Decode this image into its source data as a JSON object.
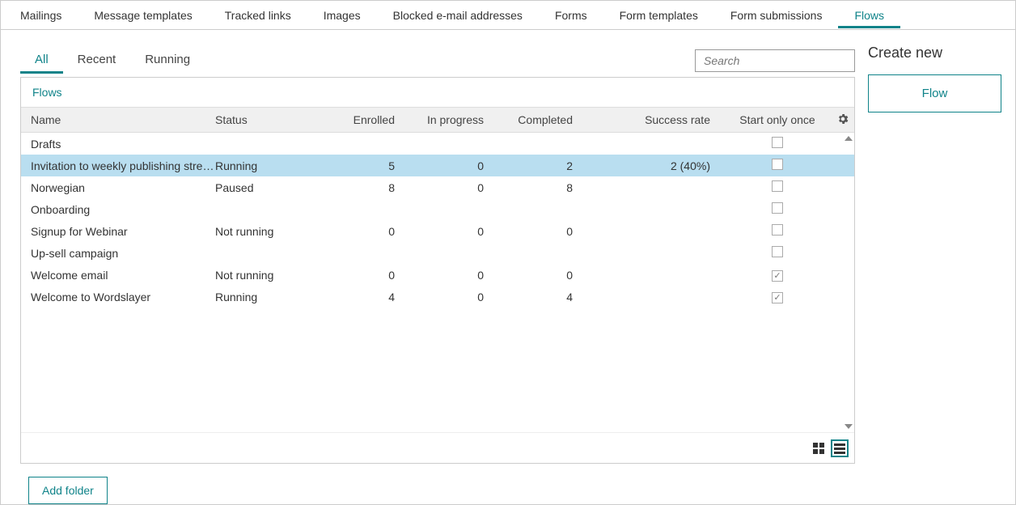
{
  "topnav": {
    "tabs": [
      {
        "label": "Mailings"
      },
      {
        "label": "Message templates"
      },
      {
        "label": "Tracked links"
      },
      {
        "label": "Images"
      },
      {
        "label": "Blocked e-mail addresses"
      },
      {
        "label": "Forms"
      },
      {
        "label": "Form templates"
      },
      {
        "label": "Form submissions"
      },
      {
        "label": "Flows",
        "active": true
      }
    ]
  },
  "side": {
    "heading": "Create new",
    "button": "Flow"
  },
  "subtabs": [
    {
      "label": "All",
      "active": true
    },
    {
      "label": "Recent"
    },
    {
      "label": "Running"
    }
  ],
  "search": {
    "placeholder": "Search"
  },
  "breadcrumb": "Flows",
  "grid": {
    "headers": {
      "name": "Name",
      "status": "Status",
      "enrolled": "Enrolled",
      "in_progress": "In progress",
      "completed": "Completed",
      "success_rate": "Success rate",
      "start_once": "Start only once"
    },
    "rows": [
      {
        "name": "Drafts",
        "status": "",
        "enrolled": "",
        "in_progress": "",
        "completed": "",
        "success_rate": "",
        "start_once": false,
        "selected": false
      },
      {
        "name": "Invitation to weekly publishing strea...",
        "status": "Running",
        "enrolled": "5",
        "in_progress": "0",
        "completed": "2",
        "success_rate": "2 (40%)",
        "start_once": false,
        "selected": true
      },
      {
        "name": "Norwegian",
        "status": "Paused",
        "enrolled": "8",
        "in_progress": "0",
        "completed": "8",
        "success_rate": "",
        "start_once": false,
        "selected": false
      },
      {
        "name": "Onboarding",
        "status": "",
        "enrolled": "",
        "in_progress": "",
        "completed": "",
        "success_rate": "",
        "start_once": false,
        "selected": false
      },
      {
        "name": "Signup for Webinar",
        "status": "Not running",
        "enrolled": "0",
        "in_progress": "0",
        "completed": "0",
        "success_rate": "",
        "start_once": false,
        "selected": false
      },
      {
        "name": "Up-sell campaign",
        "status": "",
        "enrolled": "",
        "in_progress": "",
        "completed": "",
        "success_rate": "",
        "start_once": false,
        "selected": false
      },
      {
        "name": "Welcome email",
        "status": "Not running",
        "enrolled": "0",
        "in_progress": "0",
        "completed": "0",
        "success_rate": "",
        "start_once": true,
        "selected": false
      },
      {
        "name": "Welcome to Wordslayer",
        "status": "Running",
        "enrolled": "4",
        "in_progress": "0",
        "completed": "4",
        "success_rate": "",
        "start_once": true,
        "selected": false
      }
    ]
  },
  "footer": {
    "add_folder": "Add folder"
  }
}
